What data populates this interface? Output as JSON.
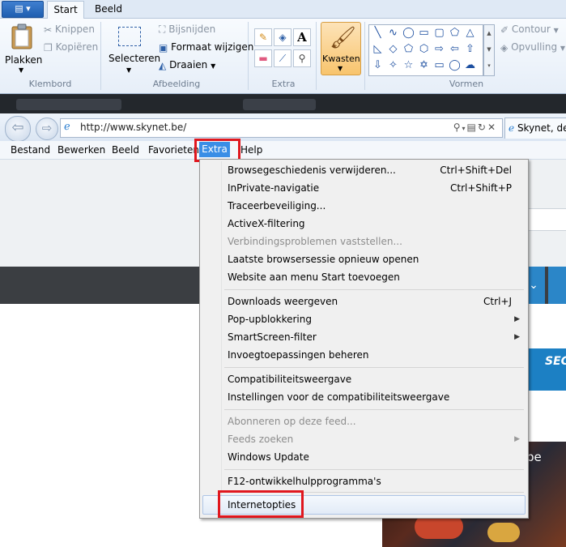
{
  "paint": {
    "tabs": [
      "Start",
      "Beeld"
    ],
    "clipboard": {
      "paste": "Plakken",
      "cut": "Knippen",
      "copy": "Kopiëren",
      "group": "Klembord"
    },
    "image": {
      "select": "Selecteren",
      "crop": "Bijsnijden",
      "resize": "Formaat wijzigen",
      "rotate": "Draaien",
      "group": "Afbeelding"
    },
    "tools": {
      "group": "Extra"
    },
    "brushes": {
      "label": "Kwasten"
    },
    "shapes": {
      "outline": "Contour",
      "fill": "Opvulling",
      "group": "Vormen"
    }
  },
  "ie": {
    "address": "http://www.skynet.be/",
    "tab_title": "Skynet, de",
    "menubar": [
      "Bestand",
      "Bewerken",
      "Beeld",
      "Favorieten",
      "Extra",
      "Help"
    ]
  },
  "dropdown": [
    {
      "label": "Browsegeschiedenis verwijderen...",
      "shortcut": "Ctrl+Shift+Del",
      "disabled": false
    },
    {
      "label": "InPrivate-navigatie",
      "shortcut": "Ctrl+Shift+P",
      "disabled": false
    },
    {
      "label": "Traceerbeveiliging...",
      "disabled": false
    },
    {
      "label": "ActiveX-filtering",
      "disabled": false
    },
    {
      "label": "Verbindingsproblemen vaststellen...",
      "disabled": true
    },
    {
      "label": "Laatste browsersessie opnieuw openen",
      "disabled": false
    },
    {
      "label": "Website aan menu Start toevoegen",
      "disabled": false
    },
    {
      "label": "Downloads weergeven",
      "shortcut": "Ctrl+J",
      "disabled": false
    },
    {
      "label": "Pop-upblokkering",
      "submenu": true,
      "disabled": false
    },
    {
      "label": "SmartScreen-filter",
      "submenu": true,
      "disabled": false
    },
    {
      "label": "Invoegtoepassingen beheren",
      "disabled": false
    },
    {
      "label": "Compatibiliteitsweergave",
      "disabled": false
    },
    {
      "label": "Instellingen voor de compatibiliteitsweergave",
      "disabled": false
    },
    {
      "label": "Abonneren op deze feed...",
      "disabled": true
    },
    {
      "label": "Feeds zoeken",
      "submenu": true,
      "disabled": true
    },
    {
      "label": "Windows Update",
      "disabled": false
    },
    {
      "label": "F12-ontwikkelhulpprogramma's",
      "disabled": false
    },
    {
      "label": "Internetopties",
      "disabled": false,
      "highlighted": true
    }
  ],
  "page": {
    "banner_text": "SEC voor",
    "photo_caption": "be"
  },
  "colors": {
    "annotation_red": "#e0171e",
    "menu_highlight": "#3a8ee6"
  }
}
